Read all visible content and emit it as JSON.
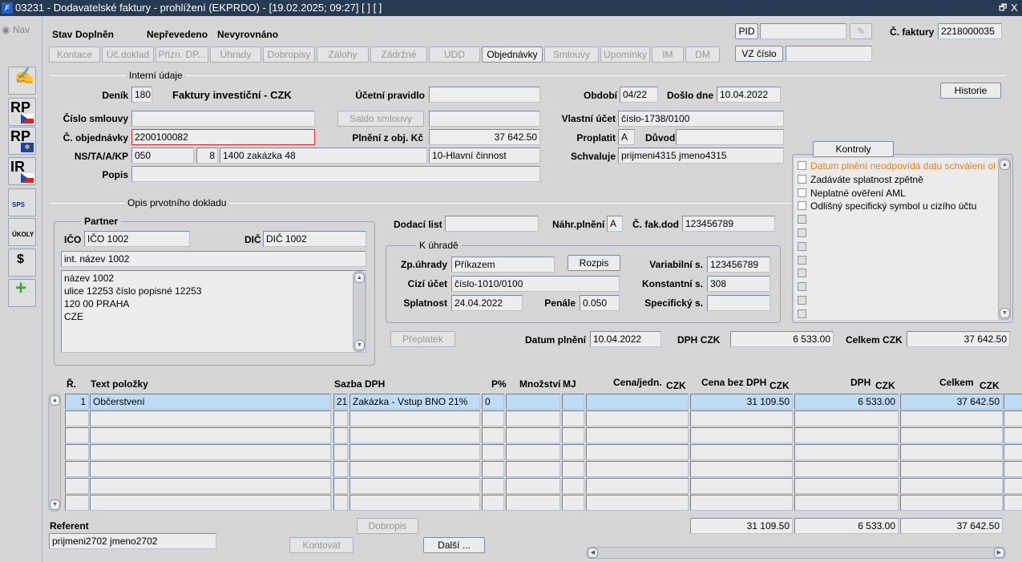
{
  "window": {
    "title": "03231 - Dodavatelské faktury - prohlížení (EKPRDO) - [19.02.2025; 09:27]  [ ]  [ ]",
    "restore": "🗗",
    "close": "X"
  },
  "nav": {
    "label": "Nav"
  },
  "toolbar": [
    {
      "name": "edit-notebook",
      "label": ""
    },
    {
      "name": "rp-cz",
      "label": "RP"
    },
    {
      "name": "rp-eu",
      "label": "RP"
    },
    {
      "name": "ir-cz",
      "label": "IR"
    },
    {
      "name": "sps",
      "label": "SPS"
    },
    {
      "name": "ukoly",
      "label": "ÚKOLY"
    },
    {
      "name": "money-bag",
      "label": "$"
    },
    {
      "name": "new-document",
      "label": "+"
    }
  ],
  "status": {
    "stav_label": "Stav",
    "stav": "Doplněn",
    "prevod": "Nepřevedeno",
    "vyrovnani": "Nevyrovnáno"
  },
  "tabs": [
    "Kontace",
    "Úč.doklad",
    "Přizn. DP...",
    "Úhrady",
    "Dobropisy",
    "Zálohy",
    "Zádržné",
    "UDD",
    "Objednávky",
    "Smlouvy",
    "Upomínky",
    "IM",
    "DM"
  ],
  "header": {
    "pid_label": "PID",
    "pid": "",
    "vz_label": "VZ číslo",
    "vz": "",
    "cislo_faktury_label": "Č. faktury",
    "cislo_faktury": "2218000035"
  },
  "interni": {
    "title": "Interní údaje",
    "denik_label": "Deník",
    "denik": "180",
    "denik_nazev": "Faktury investiční - CZK",
    "ucetni_pravidlo_label": "Účetní pravidlo",
    "ucetni_pravidlo": "",
    "obdobi_label": "Období",
    "obdobi": "04/22",
    "doslo_label": "Došlo dne",
    "doslo": "10.04.2022",
    "historie": "Historie",
    "cislo_smlouvy_label": "Číslo smlouvy",
    "cislo_smlouvy": "",
    "saldo_smlouvy": "Saldo smlouvy",
    "saldo": "",
    "vlastni_ucet_label": "Vlastní účet",
    "vlastni_ucet": "číslo-1738/0100",
    "objednavka_label": "Č. objednávky",
    "objednavka": "2200100082",
    "plneni_label": "Plnění z obj. Kč",
    "plneni": "37 642.50",
    "proplatit_label": "Proplatit",
    "proplatit": "A",
    "duvod_label": "Důvod",
    "duvod": "",
    "ns_label": "NS/TA/A/KP",
    "ns": "050",
    "ta": "8",
    "a": "1400 zakázka 48",
    "kp": "10-Hlavní činnost",
    "schvaluje_label": "Schvaluje",
    "schvaluje": "prijmeni4315 jmeno4315",
    "popis_label": "Popis",
    "popis": ""
  },
  "kontroly": {
    "button": "Kontroly",
    "items": [
      "Datum plnění neodpovídá datu schválení ol",
      "Zadáváte splatnost zpětně",
      "Neplatné ověření AML",
      "Odlišný specifický symbol u cizího účtu",
      "",
      "",
      "",
      "",
      "",
      "",
      "",
      ""
    ],
    "warn_color": "#e8821e"
  },
  "opis": {
    "title": "Opis prvotního dokladu",
    "partner_title": "Partner",
    "ico_label": "IČO",
    "ico": "IČO 1002",
    "dic_label": "DIČ",
    "dic": "DIČ 1002",
    "int_nazev": "int. název 1002",
    "adresa": [
      "název 1002",
      "ulice 12253 číslo popisné 12253",
      "120 00 PRAHA",
      "CZE"
    ],
    "dodaci_label": "Dodací list",
    "dodaci": "",
    "nahr_label": "Náhr.plnění",
    "nahr": "A",
    "fakdod_label": "Č. fak.dod",
    "fakdod": "123456789"
  },
  "uhrada": {
    "title": "K úhradě",
    "zp_label": "Zp.úhrady",
    "zp": "Příkazem",
    "rozpis": "Rozpis",
    "vs_label": "Variabilní s.",
    "vs": "123456789",
    "cizi_label": "Cizí účet",
    "cizi": "číslo-1010/0100",
    "ks_label": "Konstantní s.",
    "ks": "308",
    "splatnost_label": "Splatnost",
    "splatnost": "24.04.2022",
    "penale_label": "Penále",
    "penale": "0.050",
    "ss_label": "Specifický s.",
    "ss": ""
  },
  "summary": {
    "preplatek": "Přeplatek",
    "datum_plneni_label": "Datum plnění",
    "datum_plneni": "10.04.2022",
    "dph_label": "DPH",
    "dph_cur": "CZK",
    "dph": "6 533.00",
    "celkem_label": "Celkem",
    "celkem_cur": "CZK",
    "celkem": "37 642.50"
  },
  "table": {
    "headers": {
      "r": "Ř.",
      "text": "Text položky",
      "sazba": "Sazba DPH",
      "p": "P%",
      "mnozstvi": "Množství",
      "mj": "MJ",
      "cena_jedn": "Cena/jedn.",
      "cena_jedn_cur": "CZK",
      "cena_bez": "Cena bez DPH",
      "cena_bez_cur": "CZK",
      "dph": "DPH",
      "dph_cur": "CZK",
      "celkem": "Celkem",
      "celkem_cur": "CZK"
    },
    "rows": [
      [
        "1",
        "Občerstvení",
        "21",
        "Zakázka - Vstup BNO 21%",
        "0",
        "",
        "",
        "",
        "31 109.50",
        "6 533.00",
        "37 642.50"
      ],
      [
        "",
        "",
        "",
        "",
        "",
        "",
        "",
        "",
        "",
        "",
        ""
      ],
      [
        "",
        "",
        "",
        "",
        "",
        "",
        "",
        "",
        "",
        "",
        ""
      ],
      [
        "",
        "",
        "",
        "",
        "",
        "",
        "",
        "",
        "",
        "",
        ""
      ],
      [
        "",
        "",
        "",
        "",
        "",
        "",
        "",
        "",
        "",
        "",
        ""
      ],
      [
        "",
        "",
        "",
        "",
        "",
        "",
        "",
        "",
        "",
        "",
        ""
      ],
      [
        "",
        "",
        "",
        "",
        "",
        "",
        "",
        "",
        "",
        "",
        ""
      ]
    ],
    "totals": [
      "31 109.50",
      "6 533.00",
      "37 642.50"
    ]
  },
  "footer": {
    "referent_label": "Referent",
    "referent": "prijmeni2702 jmeno2702",
    "dobropis": "Dobropis",
    "kontovat": "Kontovat",
    "dalsi": "Další ..."
  }
}
